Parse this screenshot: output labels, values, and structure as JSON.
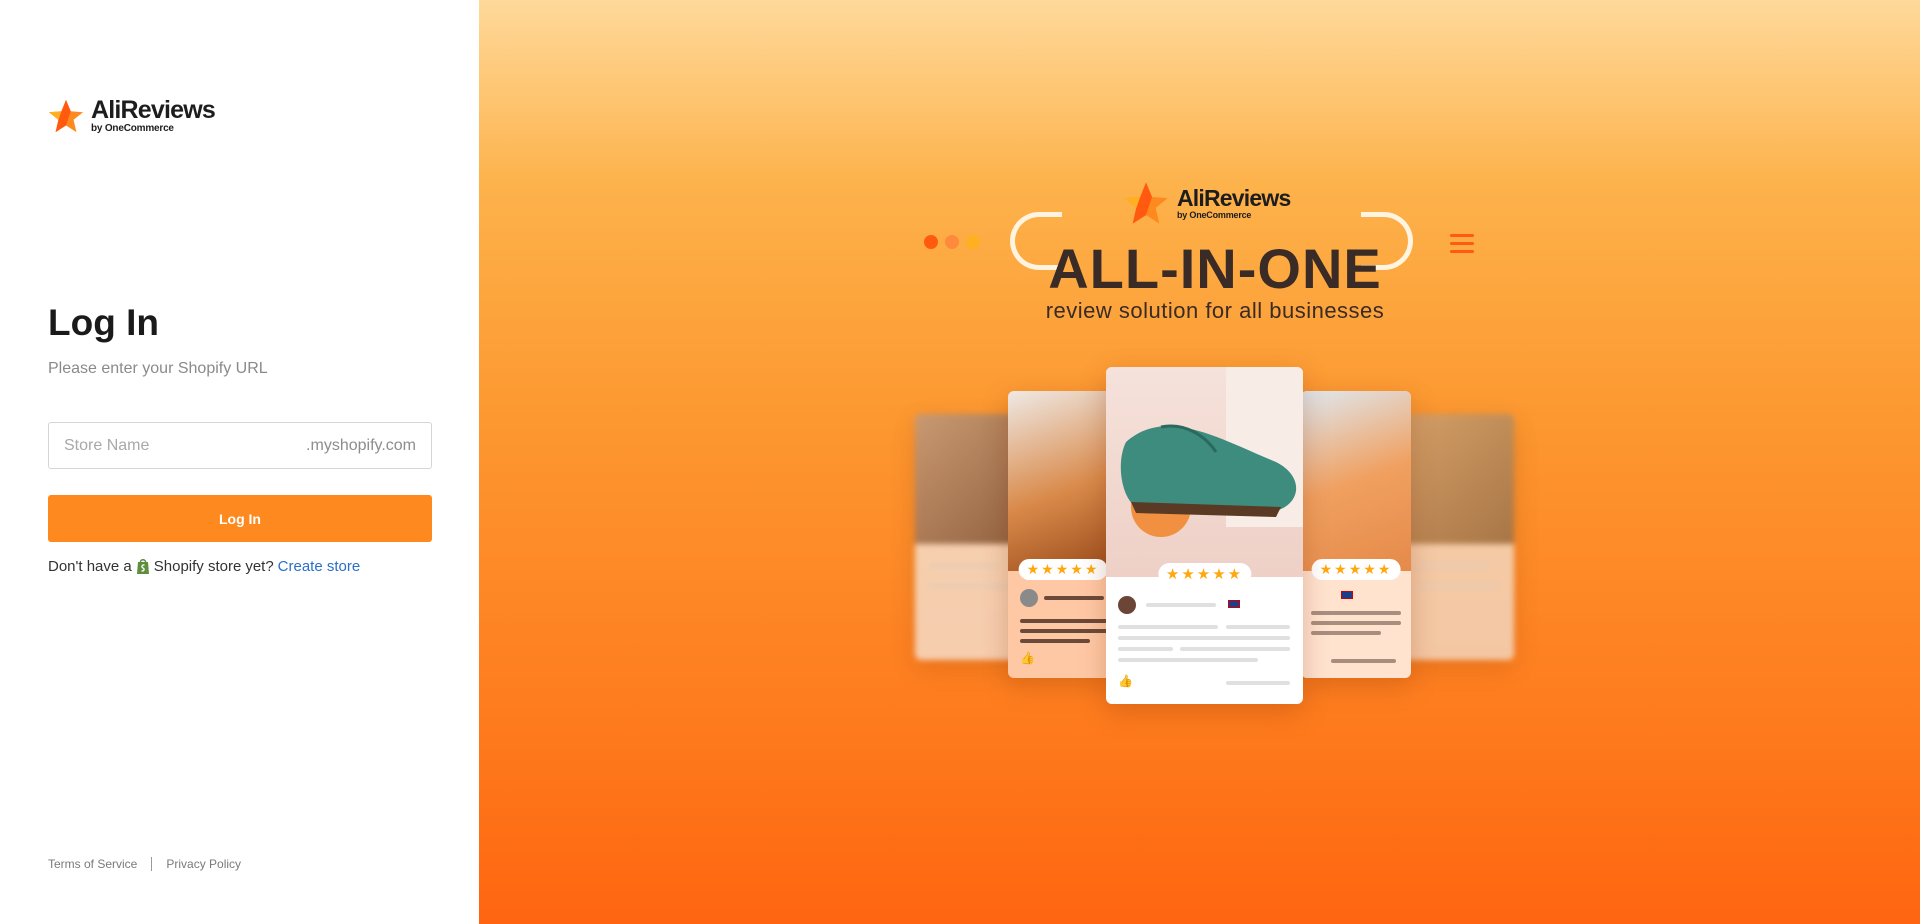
{
  "brand": {
    "name": "AliReviews",
    "byline": "by OneCommerce"
  },
  "login": {
    "title": "Log In",
    "subtitle": "Please enter your Shopify URL",
    "store_placeholder": "Store Name",
    "store_value": "",
    "store_suffix": ".myshopify.com",
    "button_label": "Log In",
    "signup_prefix": "Don't have a",
    "signup_shopify": "Shopify store",
    "signup_middle": "yet?",
    "signup_link": "Create store"
  },
  "footer": {
    "terms": "Terms of Service",
    "privacy": "Privacy Policy"
  },
  "hero": {
    "headline": "ALL-IN-ONE",
    "tagline": "review solution for all businesses",
    "rating_stars": "★★★★★",
    "dot_colors": [
      "#ff5a10",
      "#ff8a3a",
      "#ffb020"
    ]
  },
  "colors": {
    "accent": "#fe8a1f",
    "link": "#2c6ecb"
  },
  "icons": {
    "brand": "star-logo-icon",
    "shopify": "shopify-bag-icon",
    "menu": "hamburger-icon",
    "like": "thumbs-up-icon"
  }
}
